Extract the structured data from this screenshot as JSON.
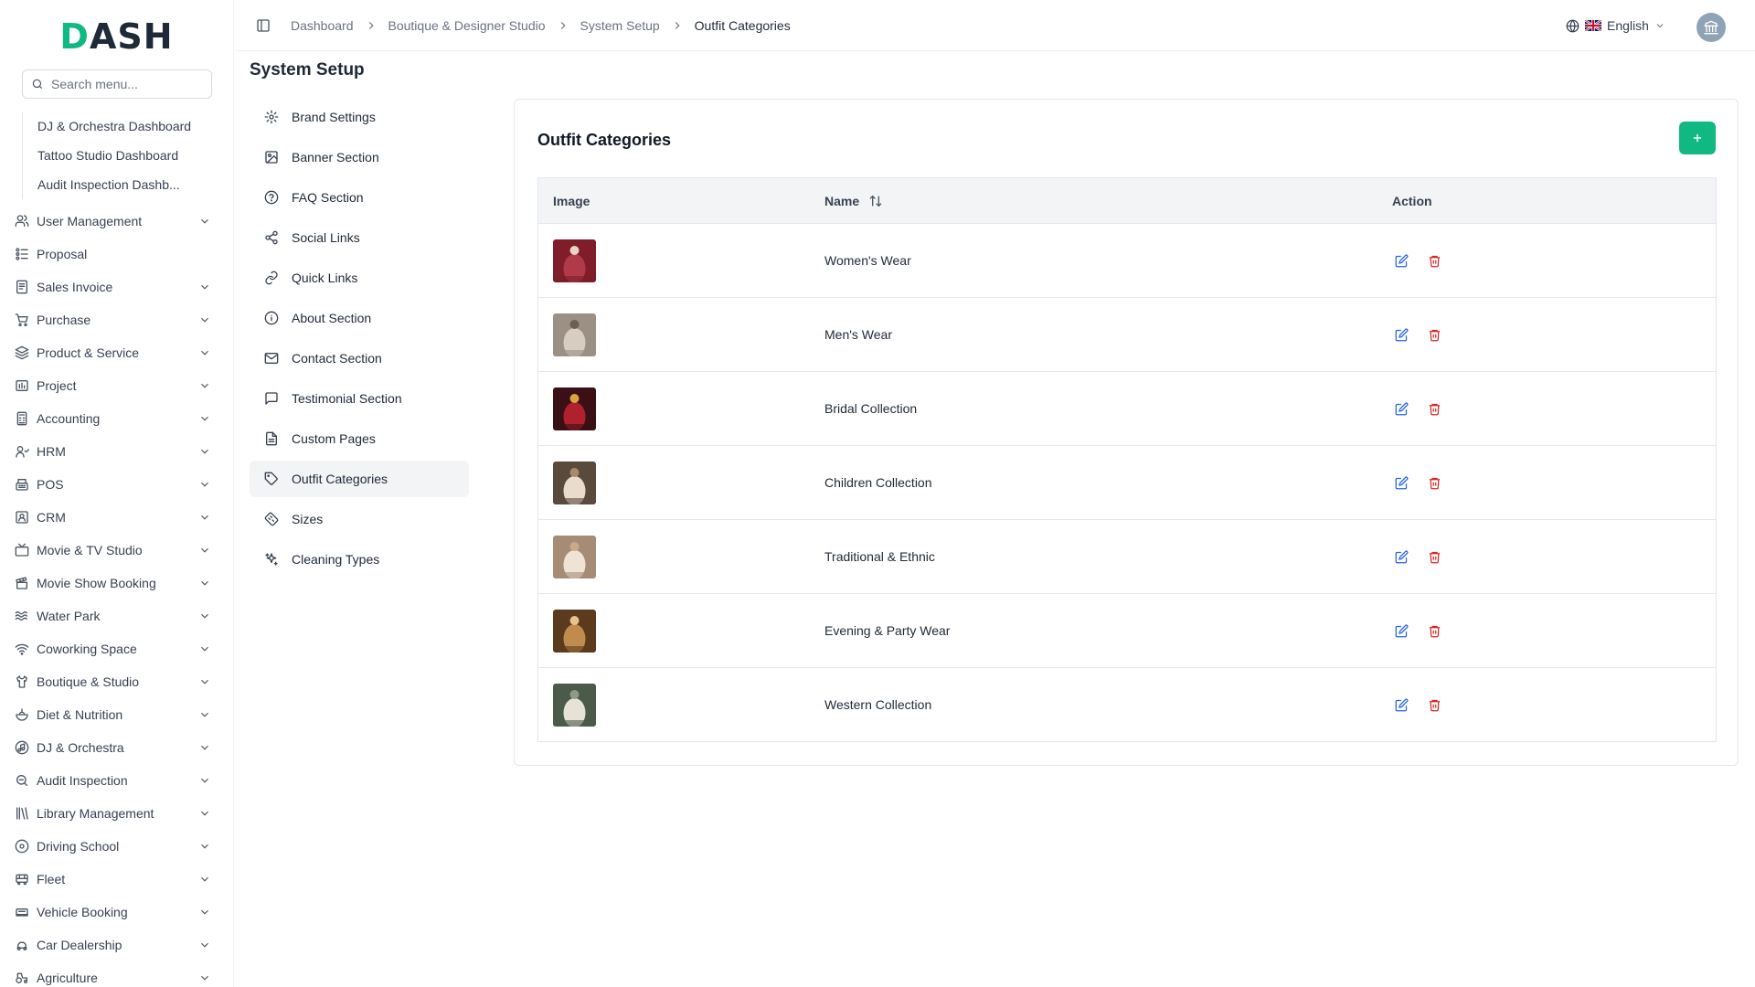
{
  "brand": {
    "logo_text": "DASH",
    "accent": "#10b981"
  },
  "sidebar": {
    "search_placeholder": "Search menu...",
    "sub_items": [
      {
        "label": "DJ & Orchestra Dashboard"
      },
      {
        "label": "Tattoo Studio Dashboard"
      },
      {
        "label": "Audit Inspection Dashb..."
      }
    ],
    "items": [
      {
        "label": "User Management",
        "icon": "users-icon",
        "chevron": true
      },
      {
        "label": "Proposal",
        "icon": "proposal-icon",
        "chevron": false
      },
      {
        "label": "Sales Invoice",
        "icon": "invoice-icon",
        "chevron": true
      },
      {
        "label": "Purchase",
        "icon": "cart-icon",
        "chevron": true
      },
      {
        "label": "Product & Service",
        "icon": "layers-icon",
        "chevron": true
      },
      {
        "label": "Project",
        "icon": "project-icon",
        "chevron": true
      },
      {
        "label": "Accounting",
        "icon": "calculator-icon",
        "chevron": true
      },
      {
        "label": "HRM",
        "icon": "hrm-icon",
        "chevron": true
      },
      {
        "label": "POS",
        "icon": "pos-icon",
        "chevron": true
      },
      {
        "label": "CRM",
        "icon": "crm-icon",
        "chevron": true
      },
      {
        "label": "Movie & TV Studio",
        "icon": "tv-icon",
        "chevron": true
      },
      {
        "label": "Movie Show Booking",
        "icon": "clapper-icon",
        "chevron": true
      },
      {
        "label": "Water Park",
        "icon": "waves-icon",
        "chevron": true
      },
      {
        "label": "Coworking Space",
        "icon": "wifi-icon",
        "chevron": true
      },
      {
        "label": "Boutique & Studio",
        "icon": "shirt-icon",
        "chevron": true
      },
      {
        "label": "Diet & Nutrition",
        "icon": "salad-icon",
        "chevron": true
      },
      {
        "label": "DJ & Orchestra",
        "icon": "music-icon",
        "chevron": true
      },
      {
        "label": "Audit Inspection",
        "icon": "search-zoom-icon",
        "chevron": true
      },
      {
        "label": "Library Management",
        "icon": "library-icon",
        "chevron": true
      },
      {
        "label": "Driving School",
        "icon": "steering-icon",
        "chevron": true
      },
      {
        "label": "Fleet",
        "icon": "bus-icon",
        "chevron": true
      },
      {
        "label": "Vehicle Booking",
        "icon": "car-booking-icon",
        "chevron": true
      },
      {
        "label": "Car Dealership",
        "icon": "car-icon",
        "chevron": true
      },
      {
        "label": "Agriculture",
        "icon": "tractor-icon",
        "chevron": true
      }
    ]
  },
  "header": {
    "breadcrumb": [
      "Dashboard",
      "Boutique & Designer Studio",
      "System Setup",
      "Outfit Categories"
    ],
    "language": "English"
  },
  "page": {
    "title": "System Setup",
    "setup_menu": [
      {
        "label": "Brand Settings",
        "icon": "gear-icon",
        "active": false
      },
      {
        "label": "Banner Section",
        "icon": "image-icon",
        "active": false
      },
      {
        "label": "FAQ Section",
        "icon": "help-circle-icon",
        "active": false
      },
      {
        "label": "Social Links",
        "icon": "share-icon",
        "active": false
      },
      {
        "label": "Quick Links",
        "icon": "link-icon",
        "active": false
      },
      {
        "label": "About Section",
        "icon": "info-icon",
        "active": false
      },
      {
        "label": "Contact Section",
        "icon": "mail-icon",
        "active": false
      },
      {
        "label": "Testimonial Section",
        "icon": "message-icon",
        "active": false
      },
      {
        "label": "Custom Pages",
        "icon": "file-icon",
        "active": false
      },
      {
        "label": "Outfit Categories",
        "icon": "tag-icon",
        "active": true
      },
      {
        "label": "Sizes",
        "icon": "ruler-icon",
        "active": false
      },
      {
        "label": "Cleaning Types",
        "icon": "sparkles-icon",
        "active": false
      }
    ]
  },
  "table": {
    "card_title": "Outfit Categories",
    "columns": {
      "image": "Image",
      "name": "Name",
      "action": "Action"
    },
    "rows": [
      {
        "name": "Women's Wear",
        "thumb": [
          "#7f1d2a",
          "#b03a48",
          "#e8d5c4"
        ]
      },
      {
        "name": "Men's Wear",
        "thumb": [
          "#9c8f84",
          "#d7cdc1",
          "#6b5e52"
        ]
      },
      {
        "name": "Bridal Collection",
        "thumb": [
          "#3a1016",
          "#b1202f",
          "#d9a441"
        ]
      },
      {
        "name": "Children Collection",
        "thumb": [
          "#5a4a3c",
          "#e9dccb",
          "#a88b6b"
        ]
      },
      {
        "name": "Traditional & Ethnic",
        "thumb": [
          "#a68c76",
          "#efe3d6",
          "#c9a98a"
        ]
      },
      {
        "name": "Evening & Party Wear",
        "thumb": [
          "#5b3a1e",
          "#c18a4e",
          "#e8c48c"
        ]
      },
      {
        "name": "Western Collection",
        "thumb": [
          "#4c5a4a",
          "#e6e2d6",
          "#8f9a86"
        ]
      }
    ]
  }
}
